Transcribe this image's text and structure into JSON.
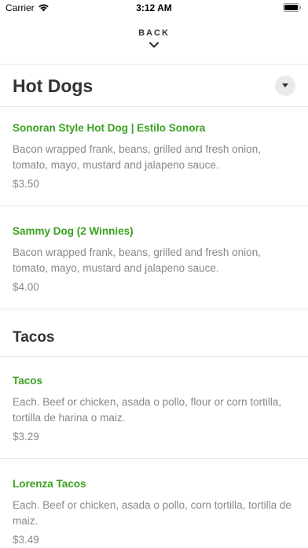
{
  "status_bar": {
    "carrier": "Carrier",
    "time": "3:12 AM"
  },
  "nav": {
    "back_label": "BACK"
  },
  "sections": [
    {
      "title": "Hot Dogs",
      "items": [
        {
          "name": "Sonoran Style Hot Dog | Estilo Sonora",
          "description": "Bacon wrapped frank, beans, grilled and fresh onion, tomato, mayo, mustard and jalapeno sauce.",
          "price": "$3.50"
        },
        {
          "name": "Sammy Dog (2 Winnies)",
          "description": "Bacon wrapped frank, beans, grilled and fresh onion, tomato, mayo, mustard and jalapeno sauce.",
          "price": "$4.00"
        }
      ]
    },
    {
      "title": "Tacos",
      "items": [
        {
          "name": "Tacos",
          "description": "Each. Beef or chicken, asada o pollo, flour or corn tortilla, tortilla de harina o maiz.",
          "price": "$3.29"
        },
        {
          "name": "Lorenza Tacos",
          "description": "Each. Beef or chicken, asada o pollo, corn tortilla, tortilla de maiz.",
          "price": "$3.49"
        }
      ]
    }
  ],
  "colors": {
    "accent": "#3aa11f",
    "text": "#333333",
    "muted": "#888888",
    "divider": "#e6e6e6"
  }
}
